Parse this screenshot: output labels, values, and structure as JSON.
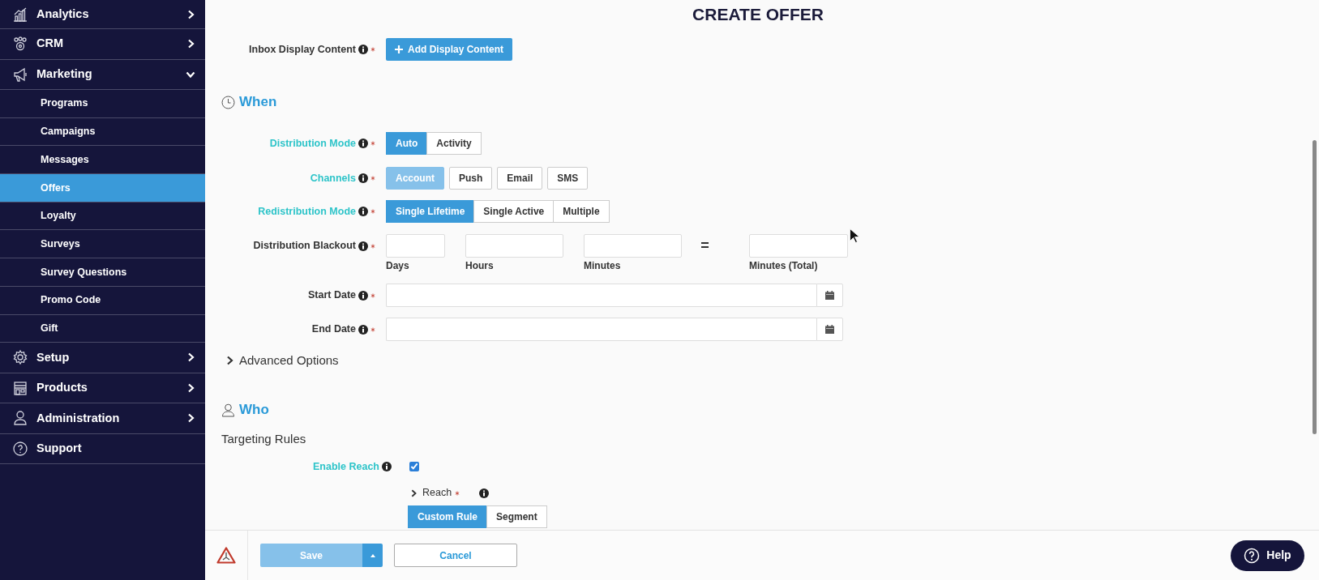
{
  "sidebar": {
    "items": [
      {
        "label": "Analytics",
        "expanded": false
      },
      {
        "label": "CRM",
        "expanded": false
      },
      {
        "label": "Marketing",
        "expanded": true,
        "children": [
          {
            "label": "Programs",
            "selected": false
          },
          {
            "label": "Campaigns",
            "selected": false
          },
          {
            "label": "Messages",
            "selected": false
          },
          {
            "label": "Offers",
            "selected": true
          },
          {
            "label": "Loyalty",
            "selected": false
          },
          {
            "label": "Surveys",
            "selected": false
          },
          {
            "label": "Survey Questions",
            "selected": false
          },
          {
            "label": "Promo Code",
            "selected": false
          },
          {
            "label": "Gift",
            "selected": false
          }
        ]
      },
      {
        "label": "Setup",
        "expanded": false
      },
      {
        "label": "Products",
        "expanded": false
      },
      {
        "label": "Administration",
        "expanded": false
      },
      {
        "label": "Support"
      }
    ]
  },
  "title": "CREATE OFFER",
  "inbox": {
    "label": "Inbox Display Content",
    "required": true,
    "button": "Add Display Content"
  },
  "when": {
    "title": "When",
    "fields": [
      {
        "kind": "segmented",
        "label": "Distribution Mode",
        "highlighted": true,
        "required": true,
        "joined": true,
        "options": [
          {
            "label": "Auto",
            "selected": true,
            "disabled": false
          },
          {
            "label": "Activity",
            "selected": false,
            "disabled": false
          }
        ]
      },
      {
        "kind": "segmented",
        "label": "Channels",
        "highlighted": true,
        "required": true,
        "joined": false,
        "options": [
          {
            "label": "Account",
            "selected": true,
            "disabled": true
          },
          {
            "label": "Push",
            "selected": false,
            "disabled": false
          },
          {
            "label": "Email",
            "selected": false,
            "disabled": false
          },
          {
            "label": "SMS",
            "selected": false,
            "disabled": false
          }
        ]
      },
      {
        "kind": "segmented",
        "label": "Redistribution Mode",
        "highlighted": true,
        "required": true,
        "joined": true,
        "options": [
          {
            "label": "Single Lifetime",
            "selected": true,
            "disabled": false
          },
          {
            "label": "Single Active",
            "selected": false,
            "disabled": false
          },
          {
            "label": "Multiple",
            "selected": false,
            "disabled": false
          }
        ]
      },
      {
        "kind": "blackout",
        "label": "Distribution Blackout",
        "highlighted": false,
        "required": true,
        "parts": [
          "Days",
          "Hours",
          "Minutes"
        ],
        "equals": "=",
        "total": "Minutes (Total)"
      },
      {
        "kind": "date",
        "label": "Start Date",
        "highlighted": false,
        "required": true
      },
      {
        "kind": "date",
        "label": "End Date",
        "highlighted": false,
        "required": true
      }
    ],
    "advanced": {
      "label": "Advanced Options",
      "expanded": false
    }
  },
  "who": {
    "title": "Who",
    "subtitle": "Targeting Rules",
    "enable": {
      "label": "Enable Reach",
      "highlighted": true,
      "checked": true
    },
    "reach": {
      "label": "Reach",
      "required": true,
      "expanded": false
    },
    "modes": [
      {
        "label": "Custom Rule",
        "selected": true
      },
      {
        "label": "Segment",
        "selected": false
      }
    ]
  },
  "footer": {
    "save": "Save",
    "save_disabled": true,
    "cancel": "Cancel",
    "help": "Help"
  }
}
